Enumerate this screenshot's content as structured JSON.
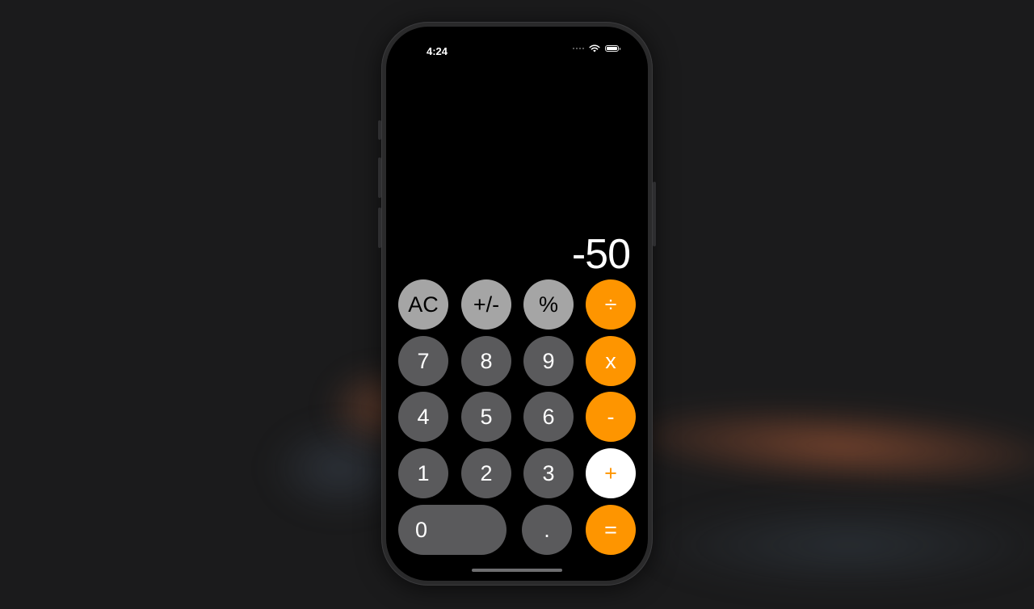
{
  "status_bar": {
    "time": "4:24",
    "icons": [
      "signal-dots-icon",
      "wifi-icon",
      "battery-icon"
    ]
  },
  "display": {
    "value": "-50"
  },
  "keys": {
    "ac": "AC",
    "plus_minus": "+/-",
    "percent": "%",
    "divide": "÷",
    "seven": "7",
    "eight": "8",
    "nine": "9",
    "multiply": "x",
    "four": "4",
    "five": "5",
    "six": "6",
    "minus": "-",
    "one": "1",
    "two": "2",
    "three": "3",
    "plus": "+",
    "zero": "0",
    "decimal": ".",
    "equals": "="
  },
  "colors": {
    "background": "#1b1b1c",
    "function_key": "#a5a5a5",
    "number_key": "#5a5a5c",
    "operator_key": "#fe9500",
    "active_operator_key": "#ffffff"
  },
  "active_operator": "plus"
}
